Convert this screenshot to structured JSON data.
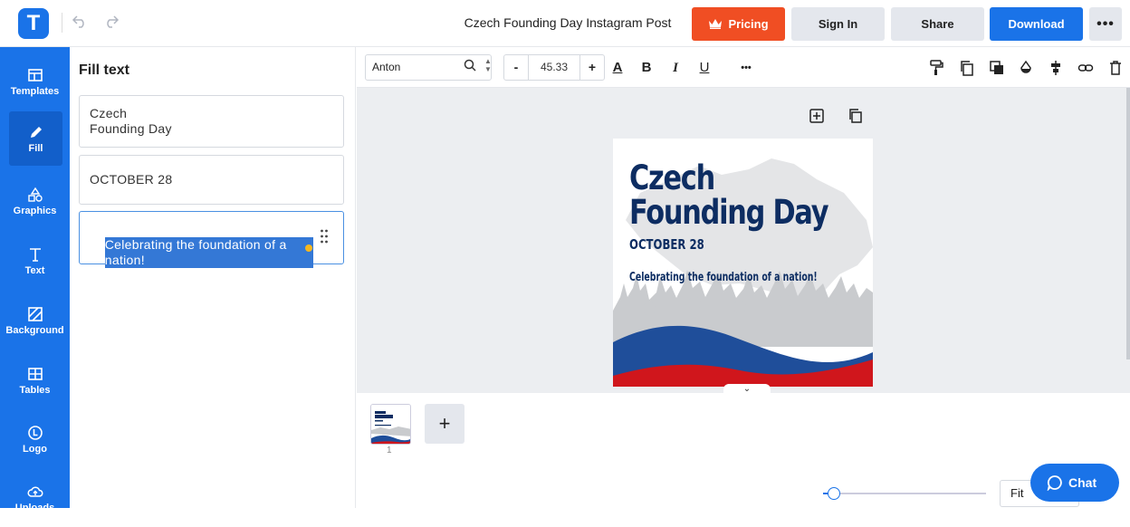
{
  "app": {
    "logo_letter": "T",
    "doc_title": "Czech Founding Day Instagram Post"
  },
  "header": {
    "pricing_label": "Pricing",
    "signin_label": "Sign In",
    "share_label": "Share",
    "download_label": "Download",
    "more_label": "•••",
    "undo_icon": "undo-icon",
    "redo_icon": "redo-icon"
  },
  "sidebar": {
    "items": [
      {
        "label": "Templates",
        "icon": "templates-icon"
      },
      {
        "label": "Fill",
        "icon": "pencil-icon"
      },
      {
        "label": "Graphics",
        "icon": "shapes-icon"
      },
      {
        "label": "Text",
        "icon": "text-icon"
      },
      {
        "label": "Background",
        "icon": "background-icon"
      },
      {
        "label": "Tables",
        "icon": "table-icon"
      },
      {
        "label": "Logo",
        "icon": "logo-icon"
      },
      {
        "label": "Uploads",
        "icon": "cloud-upload-icon"
      }
    ],
    "active": "Fill"
  },
  "panel": {
    "title": "Fill text",
    "fields": [
      {
        "value": "Czech\nFounding Day"
      },
      {
        "value": "OCTOBER 28"
      },
      {
        "value": "Celebrating the foundation of a nation!"
      }
    ]
  },
  "toolbar": {
    "font": "Anton",
    "font_size": "45.33",
    "minus_label": "-",
    "plus_label": "+",
    "bold_label": "B",
    "italic_label": "I",
    "underline_label": "U",
    "text_color_label": "A",
    "more_label": "•••"
  },
  "poster": {
    "title": "Czech\nFounding Day",
    "date": "OCTOBER 28",
    "tagline": "Celebrating the foundation of a nation!",
    "colors": {
      "navy": "#0d2d62",
      "red": "#d0161c",
      "blue": "#1f4e9a",
      "silhouette": "#c9cbce"
    }
  },
  "pages": {
    "current": "1",
    "add_label": "+"
  },
  "footer": {
    "zoom_label": "Fit",
    "zoom_level": 0.05,
    "chat_label": "Chat"
  },
  "colors": {
    "brand_blue": "#1a73e8",
    "pricing_orange": "#f04e23"
  }
}
